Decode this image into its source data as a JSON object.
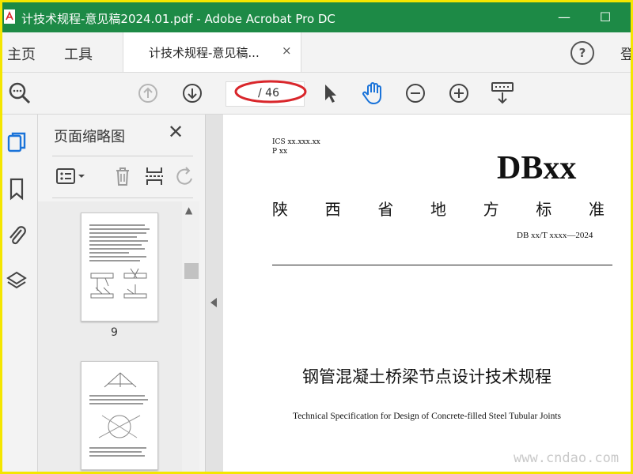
{
  "window": {
    "title": "计技术规程-意见稿2024.01.pdf - Adobe Acrobat Pro DC",
    "minimize_glyph": "—",
    "maximize_glyph": "☐"
  },
  "menu": {
    "home": "主页",
    "tools": "工具",
    "doc_tab_label": "计技术规程-意见稿...",
    "doc_tab_close": "×",
    "help": "?",
    "signin": "登"
  },
  "toolbar": {
    "page_total": "/ 46",
    "icons": [
      "zoom-search-icon",
      "page-up-icon",
      "page-down-icon",
      "select-arrow-icon",
      "hand-icon",
      "zoom-out-icon",
      "zoom-in-icon",
      "keyboard-scroll-icon"
    ]
  },
  "panel": {
    "title": "页面缩略图",
    "close": "✕",
    "thumbnails": [
      {
        "label": "9"
      },
      {
        "label": ""
      }
    ]
  },
  "document": {
    "ics": "ICS  xx.xxx.xx",
    "p": "P xx",
    "db": "DBxx",
    "province_chars": [
      "陕",
      "西",
      "省",
      "地",
      "方",
      "标",
      "准"
    ],
    "std_number": "DB xx/T xxxx—2024",
    "title_cn": "钢管混凝土桥梁节点设计技术规程",
    "title_en": "Technical Specification for Design of Concrete-filled Steel Tubular Joints"
  },
  "watermark": "www.cndao.com",
  "colors": {
    "titlebar": "#1d8a46",
    "accent_blue": "#1a73d9",
    "annotation_red": "#d9262b",
    "frame_yellow": "#f4e600"
  }
}
